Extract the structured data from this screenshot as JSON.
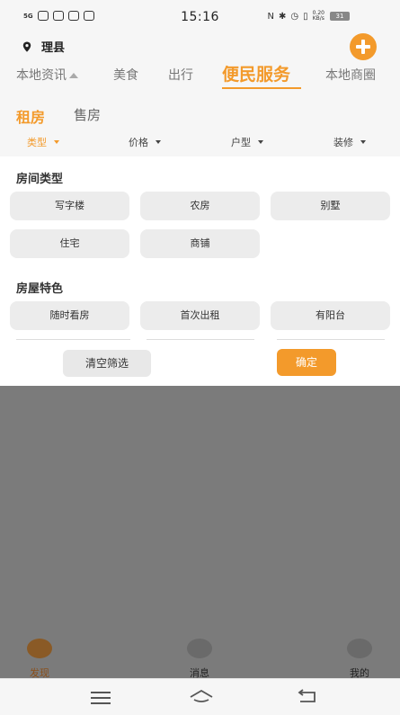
{
  "status_bar": {
    "time": "15:16",
    "network_speed": "0.20",
    "network_unit": "KB/s",
    "battery": "31",
    "signal_label": "5G"
  },
  "header": {
    "location": "理县"
  },
  "top_tabs": [
    {
      "label": "本地资讯"
    },
    {
      "label": "美食"
    },
    {
      "label": "出行"
    },
    {
      "label": "便民服务"
    },
    {
      "label": "本地商圈"
    }
  ],
  "sub_tabs": [
    {
      "label": "租房"
    },
    {
      "label": "售房"
    }
  ],
  "filters": [
    {
      "label": "类型"
    },
    {
      "label": "价格"
    },
    {
      "label": "户型"
    },
    {
      "label": "装修"
    }
  ],
  "filter_panel": {
    "room_type_title": "房间类型",
    "room_types": [
      "写字楼",
      "农房",
      "别墅",
      "住宅",
      "商铺"
    ],
    "features_title": "房屋特色",
    "features": [
      "随时看房",
      "首次出租",
      "有阳台"
    ],
    "clear_label": "清空筛选",
    "confirm_label": "确定"
  },
  "bottom_nav": [
    {
      "label": "发现"
    },
    {
      "label": "消息"
    },
    {
      "label": "我的"
    }
  ],
  "colors": {
    "accent": "#f39a2b",
    "overlay": "#7b7b7b"
  }
}
